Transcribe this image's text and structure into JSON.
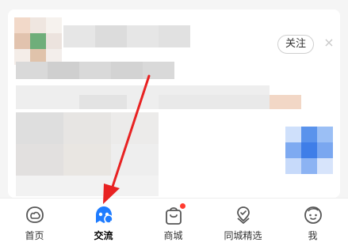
{
  "feed_card": {
    "follow_label": "关注",
    "close_glyph": "×"
  },
  "tabbar": {
    "tabs": [
      {
        "label": "首页",
        "icon": "home-icon",
        "active": false
      },
      {
        "label": "交流",
        "icon": "community-icon",
        "active": true
      },
      {
        "label": "商城",
        "icon": "shopping-bag-icon",
        "active": false,
        "badge": true
      },
      {
        "label": "同城精选",
        "icon": "local-select-icon",
        "active": false
      },
      {
        "label": "我",
        "icon": "profile-face-icon",
        "active": false
      }
    ]
  },
  "colors": {
    "accent_blue": "#1f7cff",
    "badge_red": "#ff3b30",
    "annotation_red": "#e82222"
  }
}
